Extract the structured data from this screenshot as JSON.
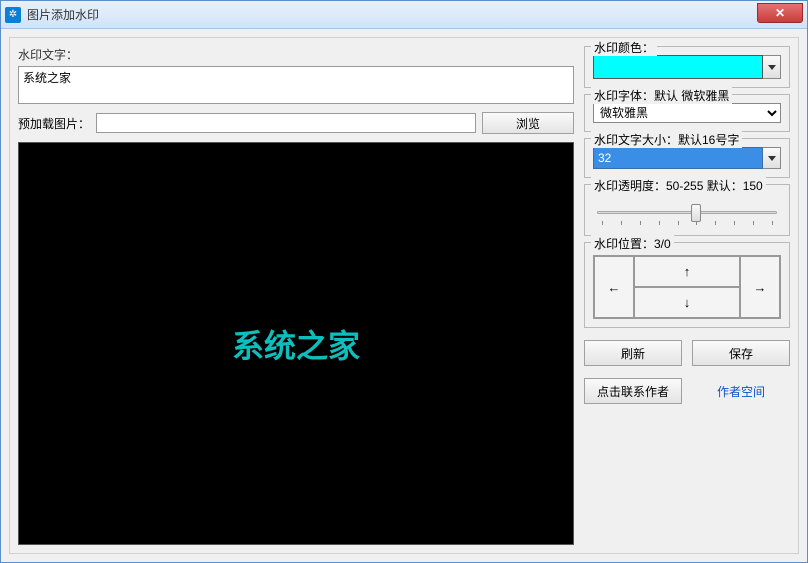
{
  "window": {
    "title": "图片添加水印"
  },
  "left": {
    "watermark_text_label": "水印文字：",
    "watermark_text_value": "系统之家",
    "preload_label": "预加载图片：",
    "preload_value": "",
    "browse_label": "浏览",
    "preview_text": "系统之家"
  },
  "right": {
    "color_label": "水印颜色：",
    "color_hex": "#00ffff",
    "font_label": "水印字体：默认 微软雅黑",
    "font_value": "微软雅黑",
    "fontsize_label": "水印文字大小：默认16号字",
    "fontsize_value": "32",
    "opacity_label": "水印透明度：50-255 默认：150",
    "position_label": "水印位置：3/0",
    "arrows": {
      "up": "↑",
      "down": "↓",
      "left": "←",
      "right": "→"
    },
    "refresh_label": "刷新",
    "save_label": "保存",
    "contact_label": "点击联系作者",
    "space_label": "作者空间"
  }
}
